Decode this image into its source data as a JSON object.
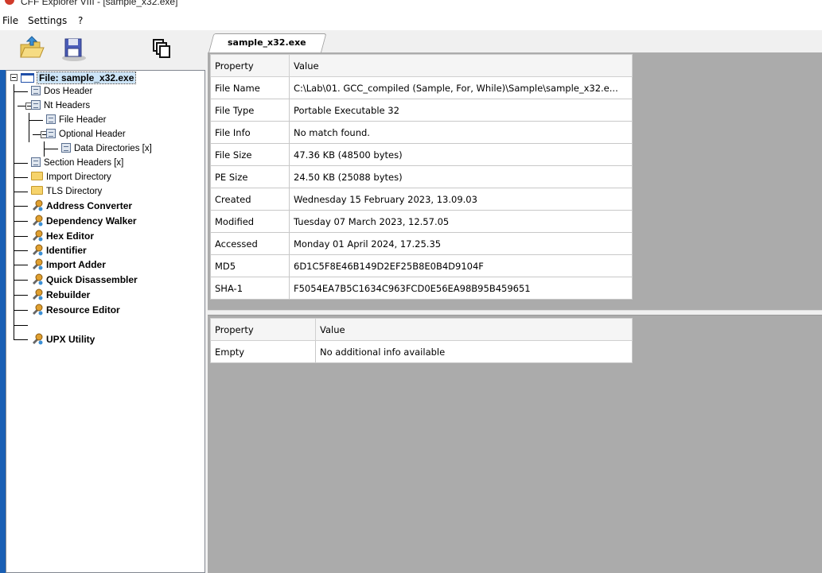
{
  "window": {
    "title": "CFF Explorer VIII - [sample_x32.exe]"
  },
  "menu": [
    "File",
    "Settings",
    "?"
  ],
  "toolbar": [
    {
      "icon": "open-folder-icon"
    },
    {
      "icon": "save-disk-icon"
    },
    {
      "icon": "windows-icon"
    }
  ],
  "tree": {
    "root": "File: sample_x32.exe",
    "items": [
      {
        "label": "Dos Header",
        "icon": "page-icon",
        "bold": false
      },
      {
        "label": "Nt Headers",
        "icon": "page-icon",
        "bold": false
      },
      {
        "label": "File Header",
        "icon": "page-icon",
        "bold": false
      },
      {
        "label": "Optional Header",
        "icon": "page-icon",
        "bold": false
      },
      {
        "label": "Data Directories [x]",
        "icon": "page-icon",
        "bold": false
      },
      {
        "label": "Section Headers [x]",
        "icon": "page-icon",
        "bold": false
      },
      {
        "label": "Import Directory",
        "icon": "folder-icon",
        "bold": false
      },
      {
        "label": "TLS Directory",
        "icon": "folder-icon",
        "bold": false
      },
      {
        "label": "Address Converter",
        "icon": "tool-icon",
        "bold": true
      },
      {
        "label": "Dependency Walker",
        "icon": "tool-icon",
        "bold": true
      },
      {
        "label": "Hex Editor",
        "icon": "tool-icon",
        "bold": true
      },
      {
        "label": "Identifier",
        "icon": "tool-icon",
        "bold": true
      },
      {
        "label": "Import Adder",
        "icon": "tool-icon",
        "bold": true
      },
      {
        "label": "Quick Disassembler",
        "icon": "tool-icon",
        "bold": true
      },
      {
        "label": "Rebuilder",
        "icon": "tool-icon",
        "bold": true
      },
      {
        "label": "Resource Editor",
        "icon": "tool-icon",
        "bold": true
      },
      {
        "label": "UPX Utility",
        "icon": "tool-icon",
        "bold": true
      }
    ]
  },
  "tab": {
    "label": "sample_x32.exe"
  },
  "top_grid": {
    "headers": [
      "Property",
      "Value"
    ],
    "rows": [
      [
        "File Name",
        "C:\\Lab\\01. GCC_compiled (Sample, For, While)\\Sample\\sample_x32.e..."
      ],
      [
        "File Type",
        "Portable Executable 32"
      ],
      [
        "File Info",
        "No match found."
      ],
      [
        "File Size",
        "47.36 KB (48500 bytes)"
      ],
      [
        "PE Size",
        "24.50 KB (25088 bytes)"
      ],
      [
        "Created",
        "Wednesday 15 February 2023, 13.09.03"
      ],
      [
        "Modified",
        "Tuesday 07 March 2023, 12.57.05"
      ],
      [
        "Accessed",
        "Monday 01 April 2024, 17.25.35"
      ],
      [
        "MD5",
        "6D1C5F8E46B149D2EF25B8E0B4D9104F"
      ],
      [
        "SHA-1",
        "F5054EA7B5C1634C963FCD0E56EA98B95B459651"
      ]
    ]
  },
  "bottom_grid": {
    "headers": [
      "Property",
      "Value"
    ],
    "rows": [
      [
        "Empty",
        "No additional info available"
      ]
    ]
  }
}
